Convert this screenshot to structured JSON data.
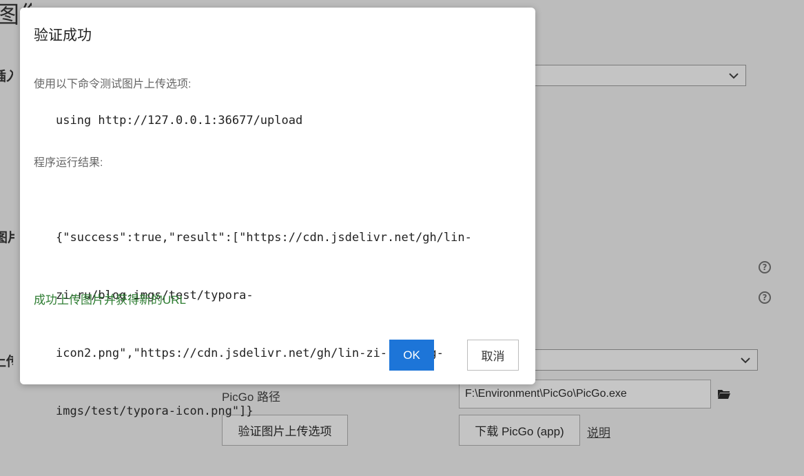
{
  "background": {
    "page_heading_fragment": "图像",
    "edge_label_1": "插入图",
    "edge_label_2": "图片语",
    "edge_label_3": "上传服",
    "picgo_path_label": "PicGo 路径",
    "picgo_path_value": "F:\\Environment\\PicGo\\PicGo.exe",
    "validate_button_label": "验证图片上传选项",
    "download_button_label": "下载 PicGo (app)",
    "docs_link_label": "说明",
    "help_glyph": "?"
  },
  "dialog": {
    "title": "验证成功",
    "test_command_intro": "使用以下命令测试图片上传选项:",
    "test_command": "using http://127.0.0.1:36677/upload",
    "result_intro": "程序运行结果:",
    "result_lines": [
      "{\"success\":true,\"result\":[\"https://cdn.jsdelivr.net/gh/lin-",
      "zi-ru/blog-imgs/test/typora-",
      "icon2.png\",\"https://cdn.jsdelivr.net/gh/lin-zi-ru/blog-",
      "imgs/test/typora-icon.png\"]}"
    ],
    "success_message": "成功上传图片并获得新的URL",
    "ok_label": "OK",
    "cancel_label": "取消"
  },
  "colors": {
    "overlay_bg": "#bcbcbc",
    "primary_button": "#1d75d8",
    "success_text": "#2e7d32"
  }
}
